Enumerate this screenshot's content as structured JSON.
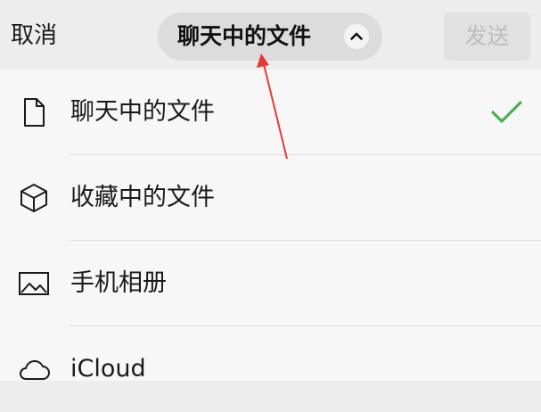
{
  "header": {
    "cancel_label": "取消",
    "title": "聊天中的文件",
    "send_label": "发送"
  },
  "list": {
    "items": [
      {
        "label": "聊天中的文件",
        "icon": "document-icon",
        "selected": true
      },
      {
        "label": "收藏中的文件",
        "icon": "cube-icon",
        "selected": false
      },
      {
        "label": "手机相册",
        "icon": "image-icon",
        "selected": false
      },
      {
        "label": "iCloud",
        "icon": "cloud-icon",
        "selected": false
      }
    ]
  },
  "colors": {
    "check": "#4caf50",
    "annotation_arrow": "#e53935",
    "send_disabled_text": "#bdbdbd"
  }
}
